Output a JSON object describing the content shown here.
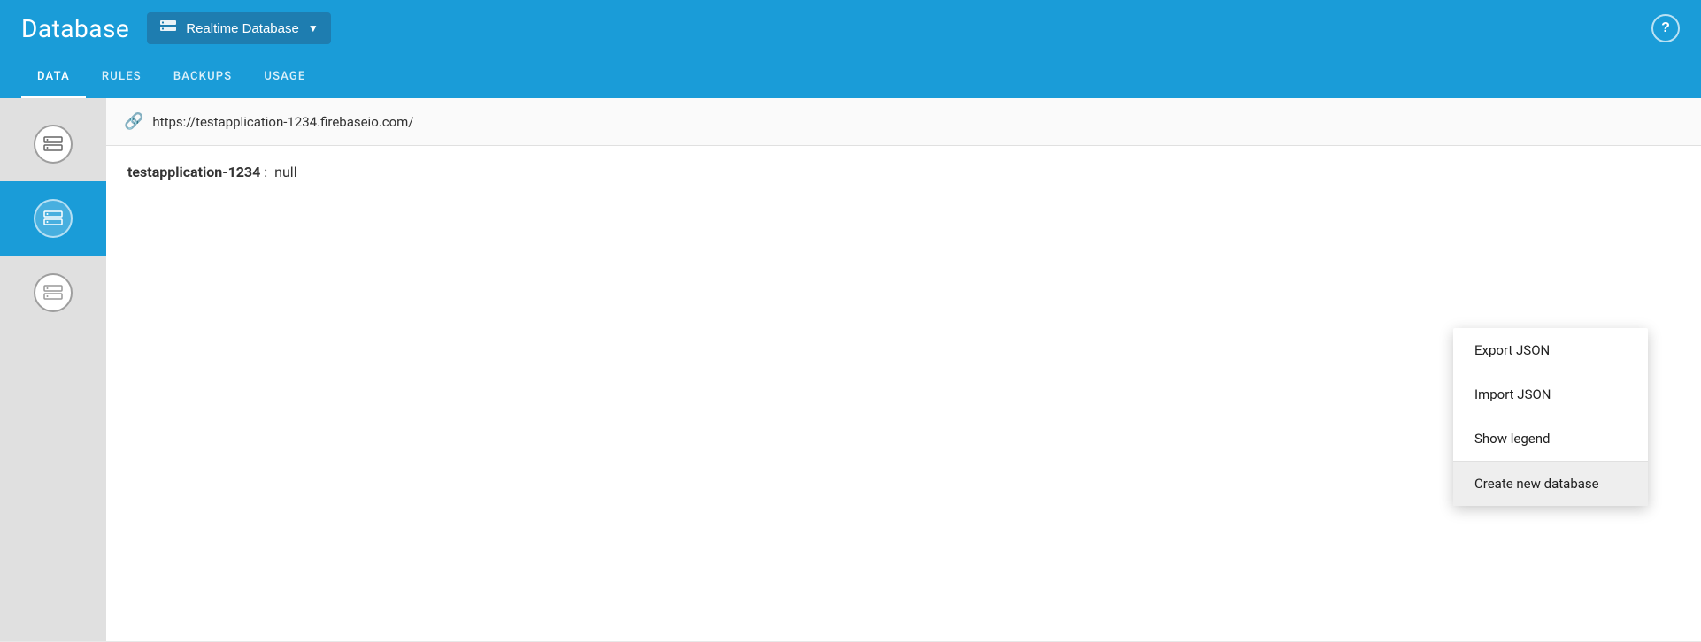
{
  "header": {
    "title": "Database",
    "selector": {
      "label": "Realtime Database",
      "icon": "database-icon"
    },
    "help_label": "?"
  },
  "nav": {
    "tabs": [
      {
        "label": "DATA",
        "active": true
      },
      {
        "label": "RULES",
        "active": false
      },
      {
        "label": "BACKUPS",
        "active": false
      },
      {
        "label": "USAGE",
        "active": false
      }
    ]
  },
  "url_bar": {
    "url": "https://testapplication-1234.firebaseio.com/"
  },
  "data": {
    "key": "testapplication-1234",
    "value": "null"
  },
  "dropdown": {
    "items": [
      {
        "label": "Export JSON",
        "highlighted": false
      },
      {
        "label": "Import JSON",
        "highlighted": false
      },
      {
        "label": "Show legend",
        "highlighted": false
      },
      {
        "label": "Create new database",
        "highlighted": true
      }
    ]
  },
  "colors": {
    "primary": "#1a9cd8",
    "dark_selector": "#1e7db0"
  }
}
